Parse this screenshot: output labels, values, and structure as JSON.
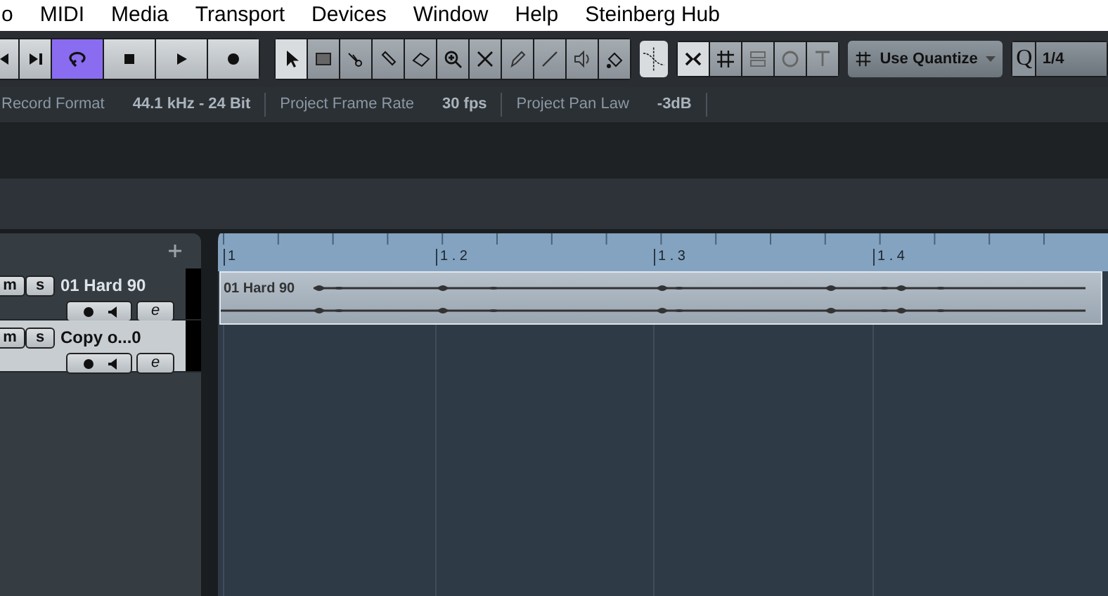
{
  "menu": [
    "o",
    "MIDI",
    "Media",
    "Transport",
    "Devices",
    "Window",
    "Help",
    "Steinberg Hub"
  ],
  "transport": [
    {
      "kind": "rewind",
      "selected": false
    },
    {
      "kind": "end",
      "selected": false
    },
    {
      "kind": "loop",
      "selected": true
    },
    {
      "kind": "stop",
      "selected": false
    },
    {
      "kind": "play",
      "selected": false
    },
    {
      "kind": "record",
      "selected": false
    }
  ],
  "tools": [
    {
      "kind": "arrow",
      "selected": true
    },
    {
      "kind": "range",
      "selected": false
    },
    {
      "kind": "split",
      "selected": false
    },
    {
      "kind": "glue",
      "selected": false
    },
    {
      "kind": "erase",
      "selected": false
    },
    {
      "kind": "zoom",
      "selected": false
    },
    {
      "kind": "mute",
      "selected": false
    },
    {
      "kind": "draw",
      "selected": false
    },
    {
      "kind": "line",
      "selected": false
    },
    {
      "kind": "speaker",
      "selected": false
    },
    {
      "kind": "color",
      "selected": false
    }
  ],
  "snap_tools": [
    {
      "kind": "snap",
      "selected": true
    },
    {
      "kind": "grid",
      "selected": false
    },
    {
      "kind": "events",
      "selected": false
    },
    {
      "kind": "shuffle",
      "selected": false
    },
    {
      "kind": "cursor",
      "selected": false
    }
  ],
  "quantize": {
    "label": "Use Quantize"
  },
  "quantize_value": {
    "label": "Q",
    "value": "1/4"
  },
  "info_line": [
    {
      "label": "Record Format",
      "value": "44.1 kHz - 24 Bit"
    },
    {
      "label": "Project Frame Rate",
      "value": "30 fps"
    },
    {
      "label": "Project Pan Law",
      "value": "-3dB"
    }
  ],
  "tracks": [
    {
      "name": "01 Hard 90",
      "selected": false,
      "mute": "m",
      "solo": "s",
      "edit": "e"
    },
    {
      "name": "Copy o...0",
      "selected": true,
      "mute": "m",
      "solo": "s",
      "edit": "e"
    }
  ],
  "ruler": [
    "1",
    "1 . 2",
    "1 . 3",
    "1 . 4"
  ],
  "event": {
    "name": "01 Hard 90"
  }
}
